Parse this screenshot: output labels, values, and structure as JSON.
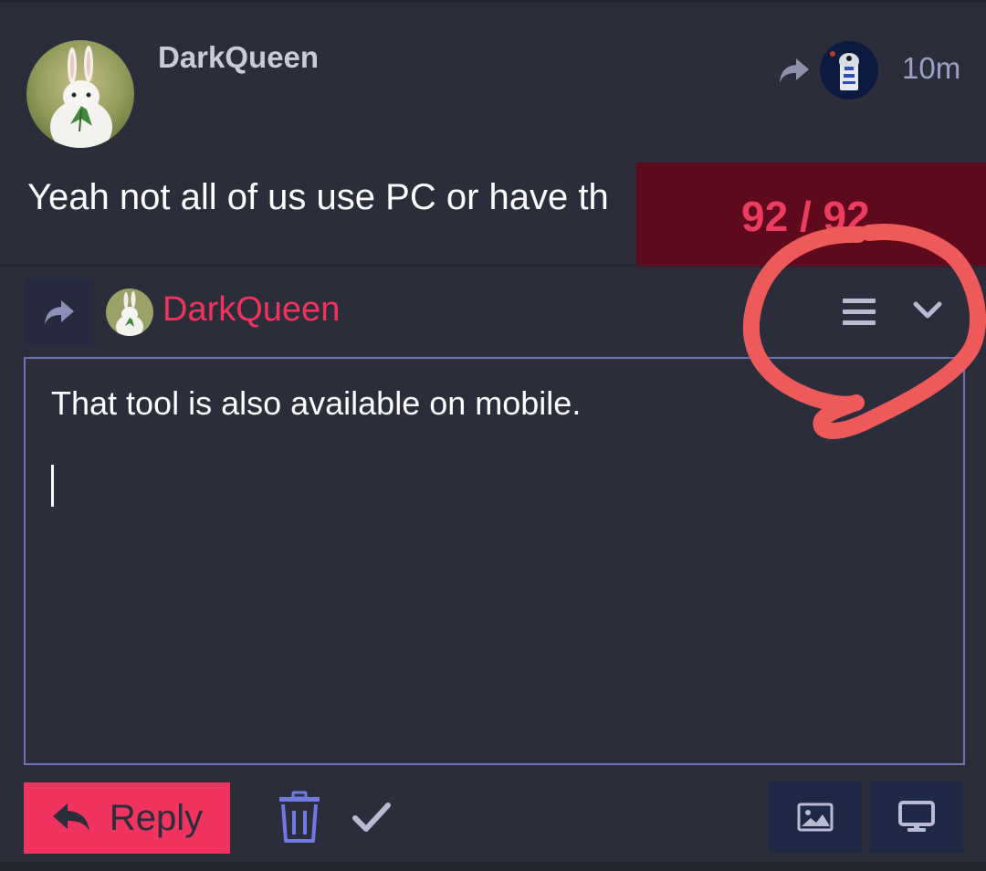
{
  "post": {
    "username": "DarkQueen",
    "time": "10m",
    "text": "Yeah not all of us use PC or have th",
    "counter": "92 / 92"
  },
  "reply": {
    "quoted_user": "DarkQueen",
    "editor_text": "That tool is also available on mobile."
  },
  "toolbar": {
    "reply_label": "Reply"
  },
  "icons": {
    "share": "share-arrow-icon",
    "menu": "hamburger-menu-icon",
    "chevron": "chevron-down-icon",
    "trash": "trash-icon",
    "check": "check-icon",
    "image": "image-icon",
    "screen": "monitor-icon"
  },
  "colors": {
    "background": "#2b2d3a",
    "accent": "#f0345f",
    "editor_border": "#6b72b8",
    "counter_bg": "#5f0a1c",
    "annotation": "#ee5a5a"
  }
}
